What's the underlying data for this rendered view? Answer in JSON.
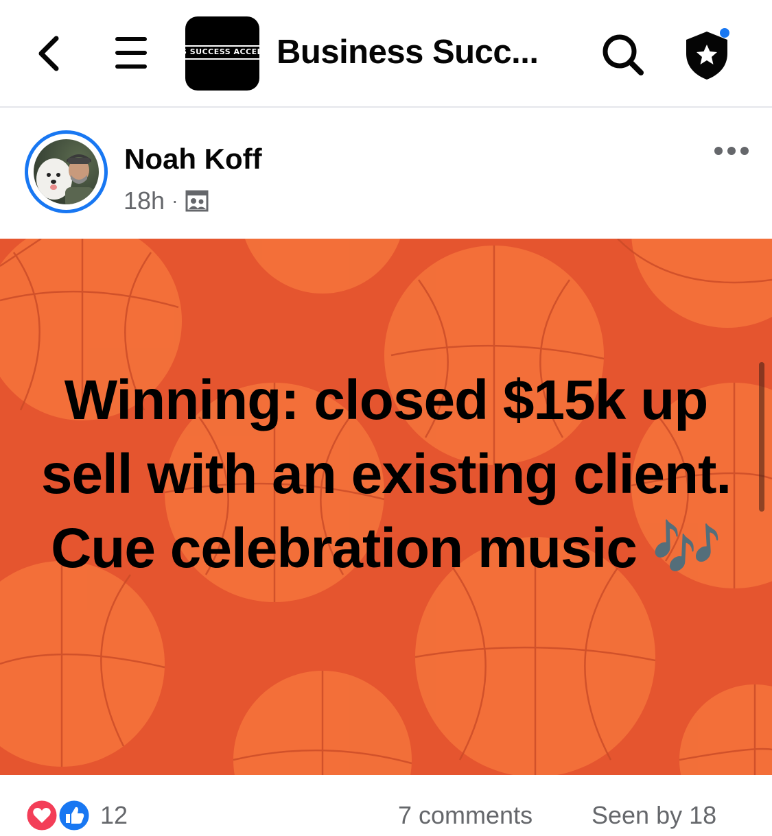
{
  "header": {
    "group_logo_text": "S SUCCESS ACCELER",
    "group_title": "Business Succ...",
    "icons": [
      "back-arrow-icon",
      "hamburger-menu-icon",
      "search-icon",
      "shield-star-icon"
    ],
    "notification_dot_color": "#1877f2"
  },
  "post": {
    "author": "Noah Koff",
    "time": "18h",
    "separator": "·",
    "audience_icon": "group-members-icon",
    "image_text": "Winning: closed $15k up sell with an existing client. Cue celebration music 🎶",
    "image_background_color": "#e8562f"
  },
  "footer": {
    "reactions": [
      "love-reaction-icon",
      "like-reaction-icon"
    ],
    "reaction_count": "12",
    "comments": "7 comments",
    "seen_by": "Seen by 18"
  },
  "colors": {
    "accent": "#1877f2",
    "secondary_text": "#65676b",
    "love": "#f33e58"
  }
}
